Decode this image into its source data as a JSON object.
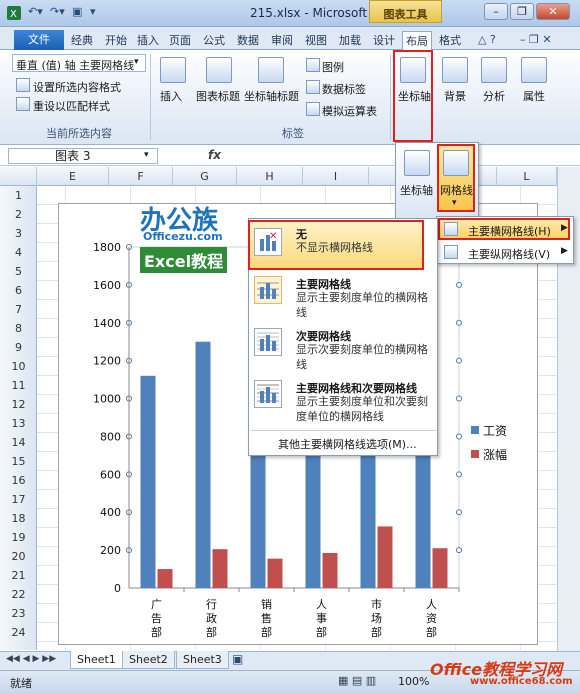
{
  "window": {
    "title": "215.xlsx - Microsoft Excel",
    "chart_tools": "图表工具"
  },
  "tabs": {
    "file": "文件",
    "items": [
      "经典",
      "开始",
      "插入",
      "页面",
      "公式",
      "数据",
      "审阅",
      "视图",
      "加载",
      "设计",
      "布局",
      "格式"
    ],
    "active": "布局"
  },
  "ribbon": {
    "selection_value": "垂直 (值) 轴 主要网格线",
    "format_selection": "设置所选内容格式",
    "reset_style": "重设以匹配样式",
    "group_current": "当前所选内容",
    "insert": "插入",
    "chart_title": "图表标题",
    "axis_titles": "坐标轴标题",
    "legend": "图例",
    "data_labels": "数据标签",
    "data_table": "模拟运算表",
    "group_labels": "标签",
    "axes": "坐标轴",
    "background": "背景",
    "analysis": "分析",
    "properties": "属性"
  },
  "axes_popup": {
    "axes": "坐标轴",
    "gridlines": "网格线",
    "fragment": "坐标"
  },
  "formula": {
    "namebox": "图表 3",
    "fx": "fx"
  },
  "columns": [
    "E",
    "F",
    "G",
    "H",
    "I",
    "J",
    "K",
    "L"
  ],
  "rows": [
    "1",
    "2",
    "3",
    "4",
    "5",
    "6",
    "7",
    "8",
    "9",
    "10",
    "11",
    "12",
    "13",
    "14",
    "15",
    "16",
    "17",
    "18",
    "19",
    "20",
    "21",
    "22",
    "23",
    "24"
  ],
  "gridlines_menu": {
    "major": "主要横网格线(H)",
    "minor": "主要纵网格线(V)"
  },
  "major_gridlines_menu": {
    "options": [
      {
        "title": "无",
        "desc": "不显示横网格线"
      },
      {
        "title": "主要网格线",
        "desc": "显示主要刻度单位的横网格线"
      },
      {
        "title": "次要网格线",
        "desc": "显示次要刻度单位的横网格线"
      },
      {
        "title": "主要网格线和次要网格线",
        "desc": "显示主要刻度单位和次要刻度单位的横网格线"
      }
    ],
    "more": "其他主要横网格线选项(M)..."
  },
  "chart_data": {
    "type": "bar",
    "categories": [
      "广告部",
      "行政部",
      "销售部",
      "人事部",
      "市场部",
      "人资部"
    ],
    "series": [
      {
        "name": "工资",
        "values": [
          1120,
          1300,
          1150,
          1150,
          1130,
          1150
        ]
      },
      {
        "name": "涨幅",
        "values": [
          100,
          205,
          155,
          185,
          325,
          210
        ]
      }
    ],
    "ylim": [
      0,
      1800
    ],
    "yticks": [
      0,
      200,
      400,
      600,
      800,
      1000,
      1200,
      1400,
      1600,
      1800
    ],
    "grid": false,
    "legend": "right",
    "colors": [
      "#4f81bd",
      "#c0504d"
    ]
  },
  "sheets": [
    "Sheet1",
    "Sheet2",
    "Sheet3"
  ],
  "status": {
    "ready": "就绪",
    "zoom": "100%"
  },
  "watermarks": {
    "logo": "办公族",
    "site": "Officezu.com",
    "tutorial": "Excel教程",
    "bottom": "Office教程学习网",
    "bottom_url": "www.office68.com"
  }
}
